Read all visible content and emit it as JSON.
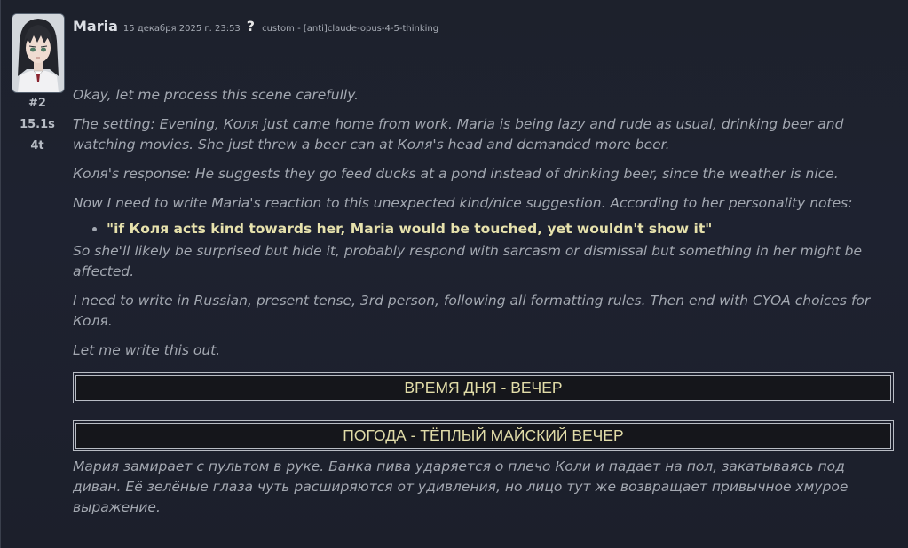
{
  "message": {
    "character_name": "Maria",
    "timestamp": "15 декабря 2025 г. 23:53",
    "help_icon": "?",
    "model": "custom - [anti]claude-opus-4-5-thinking",
    "mes_id": "#2",
    "timer": "15.1s",
    "tokens": "4t",
    "avatar_icon": "character-portrait"
  },
  "reasoning": {
    "paragraphs": [
      "Okay, let me process this scene carefully.",
      "The setting: Evening, Коля just came home from work. Maria is being lazy and rude as usual, drinking beer and watching movies. She just threw a beer can at Коля's head and demanded more beer.",
      "Коля's response: He suggests they go feed ducks at a pond instead of drinking beer, since the weather is nice.",
      "Now I need to write Maria's reaction to this unexpected kind/nice suggestion. According to her personality notes:"
    ],
    "bullet": "\"if Коля acts kind towards her, Maria would be touched, yet wouldn't show it\"",
    "after_paragraphs": [
      "So she'll likely be surprised but hide it, probably respond with sarcasm or dismissal but something in her might be affected.",
      "I need to write in Russian, present tense, 3rd person, following all formatting rules. Then end with CYOA choices for Коля.",
      "Let me write this out."
    ]
  },
  "boxes": {
    "time_of_day": "ВРЕМЯ ДНЯ - ВЕЧЕР",
    "weather": "ПОГОДА - ТЁПЛЫЙ МАЙСКИЙ ВЕЧЕР"
  },
  "narrative": "Мария замирает с пультом в руке. Банка пива ударяется о плечо Коли и падает на пол, закатываясь под диван. Её зелёные глаза чуть расширяются от удивления, но лицо тут же возвращает привычное хмурое выражение.",
  "colors": {
    "background": "#1e2230",
    "highlight_text": "#e1dca8",
    "reasoning_text": "#a3a8b1"
  }
}
